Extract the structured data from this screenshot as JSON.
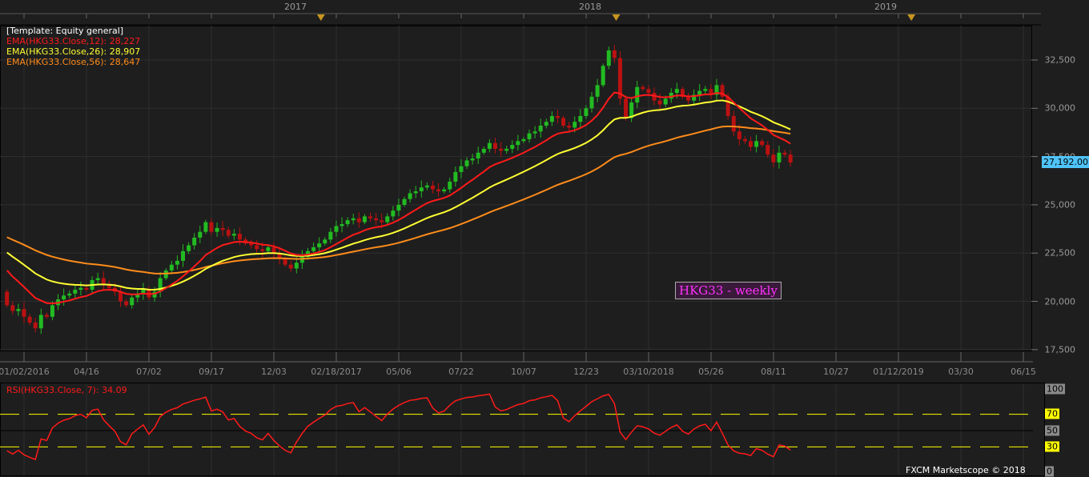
{
  "years": [
    {
      "label": "2017",
      "week": 52.3
    },
    {
      "label": "2018",
      "week": 104.3
    },
    {
      "label": "2019",
      "week": 156.3
    }
  ],
  "legend": {
    "template": "[Template: Equity general]",
    "ema12": "EMA(HKG33.Close,12): 28,227",
    "ema26": "EMA(HKG33.Close,26): 28,907",
    "ema56": "EMA(HKG33.Close,56): 28,647"
  },
  "colors": {
    "ema12": "#ff1a1a",
    "ema26": "#ffff33",
    "ema56": "#ff8c1a",
    "up": "#22bb22",
    "down": "#bb1111",
    "rsi": "#ff1a1a"
  },
  "price_axis": [
    "32,500",
    "30,000",
    "27,500",
    "25,000",
    "22,500",
    "20,000",
    "17,500"
  ],
  "last_price": "27,192.00",
  "date_labels": [
    "01/02/2016",
    "04/16",
    "07/02",
    "09/17",
    "12/03",
    "02/18/2017",
    "05/06",
    "07/22",
    "10/07",
    "12/23",
    "03/10/2018",
    "05/26",
    "08/11",
    "10/27",
    "01/12/2019",
    "03/30",
    "06/15"
  ],
  "title_box": {
    "symbol": "HKG33",
    "suffix": " - weekly"
  },
  "rsi": {
    "label": "RSI(HKG33.Close, 7): 34.09",
    "levels": [
      "100",
      "70",
      "50",
      "30",
      "0"
    ]
  },
  "footer": "FXCM Marketscope © 2018",
  "chart_data": {
    "type": "candlestick",
    "title": "HKG33 - weekly",
    "ylim": [
      17500,
      33800
    ],
    "first_week_offset": -3,
    "ema_seeds": {
      "ema12": 21930,
      "ema26": 22750,
      "ema56": 23450
    },
    "closes": [
      19800,
      19500,
      19600,
      19200,
      18900,
      18600,
      19300,
      19200,
      19800,
      20100,
      20300,
      20400,
      20600,
      20700,
      20600,
      21100,
      21200,
      20900,
      20700,
      20500,
      20000,
      19800,
      20200,
      20400,
      20600,
      20200,
      20500,
      21200,
      21600,
      21900,
      22100,
      22600,
      22900,
      23300,
      23600,
      24100,
      23600,
      23800,
      23700,
      23400,
      23500,
      23200,
      23000,
      22900,
      22700,
      22600,
      22800,
      22500,
      22200,
      21900,
      21700,
      22000,
      22300,
      22600,
      22800,
      23000,
      23200,
      23600,
      23900,
      24000,
      24200,
      24300,
      24100,
      24400,
      24300,
      24200,
      24100,
      24400,
      24700,
      25000,
      25300,
      25600,
      25700,
      25900,
      26000,
      25800,
      25700,
      25800,
      26200,
      26700,
      27000,
      27300,
      27400,
      27700,
      27900,
      28200,
      27900,
      27800,
      27900,
      28100,
      28300,
      28400,
      28700,
      28800,
      29100,
      29300,
      29600,
      29500,
      29100,
      29000,
      29300,
      29600,
      30000,
      30600,
      31200,
      32200,
      33000,
      32600,
      30500,
      29500,
      30300,
      31100,
      31000,
      30800,
      30400,
      30200,
      30500,
      30800,
      31000,
      30600,
      30400,
      30700,
      30900,
      31000,
      30700,
      31200,
      30600,
      29600,
      28800,
      28400,
      28300,
      28000,
      28300,
      28100,
      27600,
      27200,
      27700,
      27600,
      27192
    ]
  }
}
